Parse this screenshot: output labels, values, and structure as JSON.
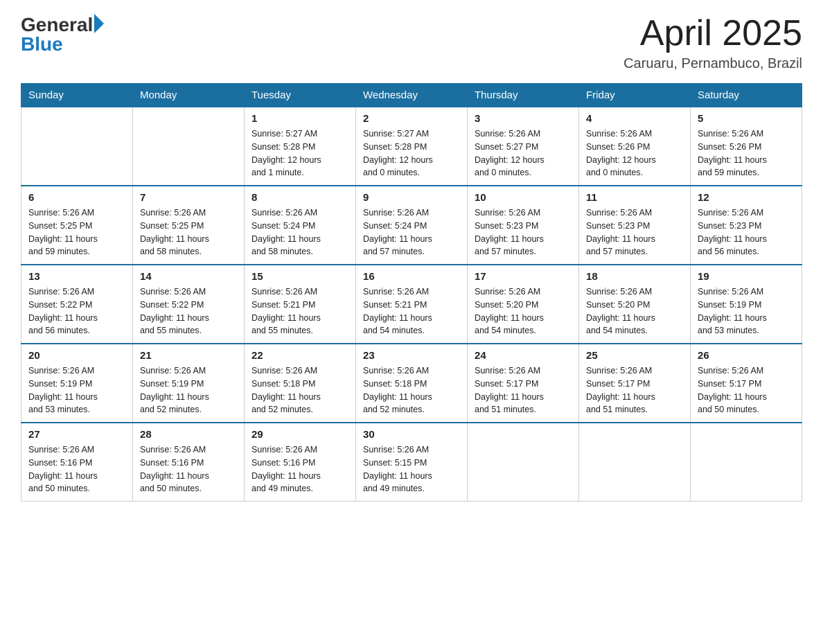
{
  "logo": {
    "general_text": "General",
    "blue_text": "Blue"
  },
  "title": "April 2025",
  "location": "Caruaru, Pernambuco, Brazil",
  "days_of_week": [
    "Sunday",
    "Monday",
    "Tuesday",
    "Wednesday",
    "Thursday",
    "Friday",
    "Saturday"
  ],
  "weeks": [
    [
      {
        "day": "",
        "info": ""
      },
      {
        "day": "",
        "info": ""
      },
      {
        "day": "1",
        "info": "Sunrise: 5:27 AM\nSunset: 5:28 PM\nDaylight: 12 hours\nand 1 minute."
      },
      {
        "day": "2",
        "info": "Sunrise: 5:27 AM\nSunset: 5:28 PM\nDaylight: 12 hours\nand 0 minutes."
      },
      {
        "day": "3",
        "info": "Sunrise: 5:26 AM\nSunset: 5:27 PM\nDaylight: 12 hours\nand 0 minutes."
      },
      {
        "day": "4",
        "info": "Sunrise: 5:26 AM\nSunset: 5:26 PM\nDaylight: 12 hours\nand 0 minutes."
      },
      {
        "day": "5",
        "info": "Sunrise: 5:26 AM\nSunset: 5:26 PM\nDaylight: 11 hours\nand 59 minutes."
      }
    ],
    [
      {
        "day": "6",
        "info": "Sunrise: 5:26 AM\nSunset: 5:25 PM\nDaylight: 11 hours\nand 59 minutes."
      },
      {
        "day": "7",
        "info": "Sunrise: 5:26 AM\nSunset: 5:25 PM\nDaylight: 11 hours\nand 58 minutes."
      },
      {
        "day": "8",
        "info": "Sunrise: 5:26 AM\nSunset: 5:24 PM\nDaylight: 11 hours\nand 58 minutes."
      },
      {
        "day": "9",
        "info": "Sunrise: 5:26 AM\nSunset: 5:24 PM\nDaylight: 11 hours\nand 57 minutes."
      },
      {
        "day": "10",
        "info": "Sunrise: 5:26 AM\nSunset: 5:23 PM\nDaylight: 11 hours\nand 57 minutes."
      },
      {
        "day": "11",
        "info": "Sunrise: 5:26 AM\nSunset: 5:23 PM\nDaylight: 11 hours\nand 57 minutes."
      },
      {
        "day": "12",
        "info": "Sunrise: 5:26 AM\nSunset: 5:23 PM\nDaylight: 11 hours\nand 56 minutes."
      }
    ],
    [
      {
        "day": "13",
        "info": "Sunrise: 5:26 AM\nSunset: 5:22 PM\nDaylight: 11 hours\nand 56 minutes."
      },
      {
        "day": "14",
        "info": "Sunrise: 5:26 AM\nSunset: 5:22 PM\nDaylight: 11 hours\nand 55 minutes."
      },
      {
        "day": "15",
        "info": "Sunrise: 5:26 AM\nSunset: 5:21 PM\nDaylight: 11 hours\nand 55 minutes."
      },
      {
        "day": "16",
        "info": "Sunrise: 5:26 AM\nSunset: 5:21 PM\nDaylight: 11 hours\nand 54 minutes."
      },
      {
        "day": "17",
        "info": "Sunrise: 5:26 AM\nSunset: 5:20 PM\nDaylight: 11 hours\nand 54 minutes."
      },
      {
        "day": "18",
        "info": "Sunrise: 5:26 AM\nSunset: 5:20 PM\nDaylight: 11 hours\nand 54 minutes."
      },
      {
        "day": "19",
        "info": "Sunrise: 5:26 AM\nSunset: 5:19 PM\nDaylight: 11 hours\nand 53 minutes."
      }
    ],
    [
      {
        "day": "20",
        "info": "Sunrise: 5:26 AM\nSunset: 5:19 PM\nDaylight: 11 hours\nand 53 minutes."
      },
      {
        "day": "21",
        "info": "Sunrise: 5:26 AM\nSunset: 5:19 PM\nDaylight: 11 hours\nand 52 minutes."
      },
      {
        "day": "22",
        "info": "Sunrise: 5:26 AM\nSunset: 5:18 PM\nDaylight: 11 hours\nand 52 minutes."
      },
      {
        "day": "23",
        "info": "Sunrise: 5:26 AM\nSunset: 5:18 PM\nDaylight: 11 hours\nand 52 minutes."
      },
      {
        "day": "24",
        "info": "Sunrise: 5:26 AM\nSunset: 5:17 PM\nDaylight: 11 hours\nand 51 minutes."
      },
      {
        "day": "25",
        "info": "Sunrise: 5:26 AM\nSunset: 5:17 PM\nDaylight: 11 hours\nand 51 minutes."
      },
      {
        "day": "26",
        "info": "Sunrise: 5:26 AM\nSunset: 5:17 PM\nDaylight: 11 hours\nand 50 minutes."
      }
    ],
    [
      {
        "day": "27",
        "info": "Sunrise: 5:26 AM\nSunset: 5:16 PM\nDaylight: 11 hours\nand 50 minutes."
      },
      {
        "day": "28",
        "info": "Sunrise: 5:26 AM\nSunset: 5:16 PM\nDaylight: 11 hours\nand 50 minutes."
      },
      {
        "day": "29",
        "info": "Sunrise: 5:26 AM\nSunset: 5:16 PM\nDaylight: 11 hours\nand 49 minutes."
      },
      {
        "day": "30",
        "info": "Sunrise: 5:26 AM\nSunset: 5:15 PM\nDaylight: 11 hours\nand 49 minutes."
      },
      {
        "day": "",
        "info": ""
      },
      {
        "day": "",
        "info": ""
      },
      {
        "day": "",
        "info": ""
      }
    ]
  ]
}
